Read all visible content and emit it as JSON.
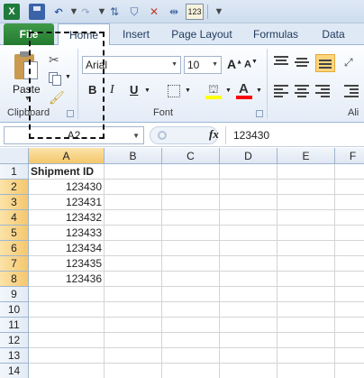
{
  "app": {
    "logo_letter": "X"
  },
  "qat": {
    "icons": [
      "excel-logo-icon",
      "save-icon",
      "undo-icon",
      "redo-icon",
      "sort-icon",
      "filter-icon",
      "clear-filter-icon",
      "text-to-columns-icon",
      "customize-icon"
    ]
  },
  "tabs": [
    "File",
    "Home",
    "Insert",
    "Page Layout",
    "Formulas",
    "Data"
  ],
  "ribbon": {
    "clipboard": {
      "paste_label": "Paste",
      "group_label": "Clipboard"
    },
    "font": {
      "font_name": "Arial",
      "font_size": "10",
      "group_label": "Font",
      "bold": "B",
      "italic": "I",
      "underline": "U",
      "grow": "A",
      "shrink": "A",
      "font_color_letter": "A",
      "fill_color": "#ffff00",
      "font_color": "#ff0000"
    },
    "alignment": {
      "group_label": "Ali"
    }
  },
  "formula_bar": {
    "name_box": "A2",
    "fx": "fx",
    "content": "123430"
  },
  "sheet": {
    "columns": [
      "A",
      "B",
      "C",
      "D",
      "E",
      "F"
    ],
    "rows": [
      "1",
      "2",
      "3",
      "4",
      "5",
      "6",
      "7",
      "8",
      "9",
      "10",
      "11",
      "12",
      "13",
      "14"
    ],
    "header_cell": "Shipment ID",
    "values": [
      "123430",
      "123431",
      "123432",
      "123433",
      "123434",
      "123435",
      "123436"
    ]
  }
}
